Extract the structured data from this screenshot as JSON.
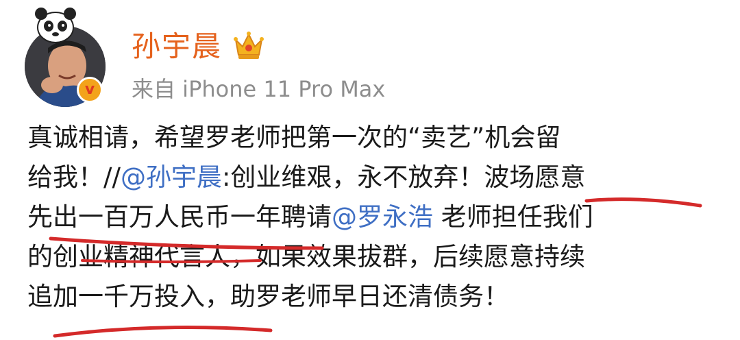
{
  "post": {
    "author": {
      "name": "孙宇晨",
      "source": "来自 iPhone 11 Pro Max",
      "badge": "v"
    },
    "lines": [
      {
        "parts": [
          {
            "text": "真诚相请，希望罗老师把第一次的“卖艺”机会留",
            "kind": "text"
          }
        ]
      },
      {
        "parts": [
          {
            "text": "给我！//",
            "kind": "text"
          },
          {
            "text": "@孙宇晨",
            "kind": "mention"
          },
          {
            "text": ":创业维艰，永不放弃！波场愿意",
            "kind": "text"
          }
        ]
      },
      {
        "parts": [
          {
            "text": "先出一百万人民币一年聘请",
            "kind": "text"
          },
          {
            "text": "@罗永浩",
            "kind": "mention"
          },
          {
            "text": " 老师担任我们",
            "kind": "text"
          }
        ]
      },
      {
        "parts": [
          {
            "text": "的创业精神代言人，如果效果拔群，后续愿意持续",
            "kind": "text"
          }
        ]
      },
      {
        "parts": [
          {
            "text": "追加一千万投入，助罗老师早日还清债务！",
            "kind": "text"
          }
        ]
      }
    ]
  },
  "colors": {
    "username": "#e5621d",
    "mention": "#3f6fc4",
    "source": "#8d8d8d",
    "underline": "#d42a2a",
    "badge": "#f3a31b"
  },
  "icons": {
    "crown": "crown-icon",
    "badge": "verified-badge-icon",
    "sticker": "panda-sticker-icon"
  }
}
